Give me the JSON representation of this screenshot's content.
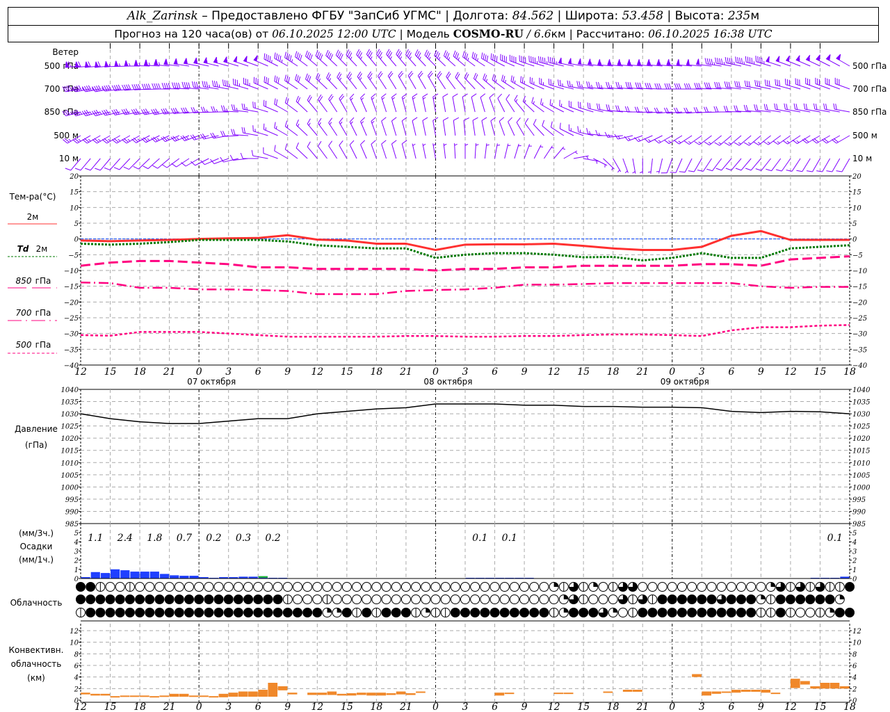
{
  "header": {
    "station": "Alk_Zarinsk",
    "provider": " – Предоставлено ФГБУ \"ЗапСиб УГМС\" | Долгота: ",
    "lon": "84.562",
    "lat_label": " | Широта: ",
    "lat": "53.458",
    "alt_label": " | Высота: ",
    "alt": "235",
    "alt_unit": "м",
    "forecast_prefix": "Прогноз на 120 часа(ов) от ",
    "forecast_time": "06.10.2025 12:00 UTC",
    "model_label": " | Модель ",
    "model": "COSMO-RU",
    "res_sep": " / ",
    "resolution": "6.6",
    "res_unit": "км",
    "calc_label": " | Рассчитано: ",
    "calc_time": "06.10.2025 16:38 UTC"
  },
  "labels": {
    "wind": "Ветер",
    "wind_levels": [
      "500 гПа",
      "700 гПа",
      "850 гПа",
      "500 м",
      "10 м"
    ],
    "temp_title": "Тем-ра(°С)",
    "t2m": "2м",
    "td_prefix": "Td",
    "td2m": "2м",
    "t850": "850",
    "t700": "700",
    "t500": "500",
    "hpa": "гПа",
    "pressure": "Давление",
    "pressure_unit": "(гПа)",
    "precip_3h": "(мм/3ч.)",
    "precip": "Осадки",
    "precip_1h": "(мм/1ч.)",
    "clouds": "Облачность",
    "conv1": "Конвективн.",
    "conv2": "облачность",
    "conv3": "(км)"
  },
  "time_axis": {
    "labels": [
      "12",
      "15",
      "18",
      "21",
      "0",
      "3",
      "6",
      "9",
      "12",
      "15",
      "18",
      "21",
      "0",
      "3",
      "6",
      "9",
      "12",
      "15",
      "18",
      "21",
      "0",
      "3",
      "6",
      "9",
      "12",
      "15",
      "18"
    ],
    "midnights_hours": [
      12,
      36,
      60
    ],
    "dates": [
      "07 октября",
      "08 октября",
      "09 октября"
    ]
  },
  "colors": {
    "wind": "#8000ff",
    "t2m": "#ff3030",
    "td2m": "#007a00",
    "upper": "#ff0080",
    "zero": "#0040ff",
    "pressure": "#000000",
    "precip": "#2040ff",
    "precip_mixed": "#20c020",
    "convective": "#f0882a"
  },
  "chart_data": [
    {
      "type": "barbs",
      "title": "Ветер",
      "step_hours": 3,
      "units": "m/s",
      "levels": [
        {
          "name": "500 гПа",
          "dir": [
            265,
            265,
            270,
            275,
            280,
            285,
            290,
            300,
            310,
            315,
            320,
            320,
            315,
            310,
            300,
            290,
            285,
            280,
            275,
            275,
            275,
            275,
            280,
            285,
            290,
            295,
            300
          ],
          "speed": [
            28,
            27,
            26,
            25,
            24,
            22,
            20,
            18,
            16,
            15,
            14,
            13,
            13,
            14,
            15,
            16,
            18,
            20,
            22,
            22,
            22,
            20,
            18,
            18,
            20,
            22,
            24
          ]
        },
        {
          "name": "700 гПа",
          "dir": [
            260,
            260,
            265,
            270,
            275,
            280,
            290,
            300,
            310,
            320,
            325,
            330,
            330,
            320,
            310,
            300,
            290,
            280,
            275,
            275,
            270,
            270,
            275,
            280,
            285,
            290,
            290
          ],
          "speed": [
            18,
            17,
            16,
            15,
            15,
            14,
            13,
            12,
            11,
            10,
            9,
            8,
            8,
            8,
            9,
            10,
            10,
            10,
            10,
            11,
            12,
            12,
            12,
            12,
            12,
            12,
            12
          ]
        },
        {
          "name": "850 гПа",
          "dir": [
            255,
            255,
            260,
            260,
            265,
            270,
            280,
            300,
            320,
            330,
            340,
            345,
            350,
            350,
            340,
            320,
            300,
            290,
            280,
            270,
            265,
            265,
            270,
            275,
            280,
            280,
            280
          ],
          "speed": [
            14,
            13,
            12,
            12,
            11,
            10,
            9,
            8,
            7,
            7,
            6,
            6,
            5,
            4,
            4,
            5,
            6,
            7,
            8,
            8,
            8,
            7,
            7,
            7,
            8,
            8,
            8
          ]
        },
        {
          "name": "500 м",
          "dir": [
            240,
            240,
            240,
            245,
            250,
            260,
            280,
            300,
            320,
            330,
            340,
            345,
            350,
            355,
            345,
            330,
            310,
            290,
            270,
            250,
            240,
            235,
            230,
            230,
            235,
            240,
            240
          ],
          "speed": [
            10,
            10,
            10,
            9,
            9,
            8,
            7,
            6,
            5,
            5,
            5,
            4,
            4,
            3,
            3,
            4,
            4,
            5,
            5,
            5,
            6,
            6,
            6,
            6,
            6,
            7,
            7
          ]
        },
        {
          "name": "10 м",
          "dir": [
            220,
            220,
            225,
            230,
            240,
            250,
            270,
            300,
            320,
            330,
            340,
            345,
            350,
            0,
            10,
            20,
            40,
            100,
            150,
            180,
            200,
            210,
            220,
            220,
            215,
            210,
            210
          ],
          "speed": [
            3,
            3,
            3,
            3,
            3,
            3,
            3,
            3,
            3,
            3,
            3,
            3,
            2,
            2,
            2,
            2,
            2,
            2,
            2,
            2,
            3,
            3,
            3,
            3,
            3,
            3,
            3
          ]
        }
      ]
    },
    {
      "type": "line",
      "title": "Тем-ра(°С)",
      "step_hours": 3,
      "ylim": [
        -40,
        20
      ],
      "yticks": [
        20,
        15,
        10,
        5,
        0,
        -5,
        -10,
        -15,
        -20,
        -25,
        -30,
        -35,
        -40
      ],
      "grid": true,
      "series": [
        {
          "name": "2м",
          "values": [
            -0.5,
            -0.7,
            -0.5,
            -0.3,
            0,
            0.2,
            0.3,
            1.2,
            -0.2,
            -0.5,
            -1.5,
            -1.5,
            -3.5,
            -1.8,
            -1.7,
            -1.7,
            -1.5,
            -2.2,
            -3.0,
            -3.5,
            -3.5,
            -2.5,
            1.0,
            2.5,
            -0.3,
            -0.3,
            -0.3
          ]
        },
        {
          "name": "Td 2м",
          "values": [
            -1.5,
            -1.8,
            -1.5,
            -1,
            -0.3,
            -0.3,
            -0.3,
            -0.8,
            -2,
            -2.5,
            -3,
            -3,
            -6,
            -5,
            -4.5,
            -4.5,
            -5,
            -5.8,
            -5.7,
            -6.8,
            -6,
            -4.5,
            -6,
            -6,
            -3,
            -2.5,
            -2
          ]
        },
        {
          "name": "850 гПа",
          "values": [
            -8.5,
            -7.5,
            -7,
            -7,
            -7.5,
            -8,
            -9,
            -9,
            -9.5,
            -9.5,
            -9.5,
            -9.5,
            -10,
            -9.5,
            -9.5,
            -9,
            -9,
            -8.5,
            -8.5,
            -8.5,
            -8.5,
            -8,
            -8,
            -8.5,
            -6.5,
            -6,
            -5.5
          ]
        },
        {
          "name": "700 гПа",
          "values": [
            -13.8,
            -14,
            -15.5,
            -15.5,
            -16,
            -16,
            -16.2,
            -16.5,
            -17.5,
            -17.5,
            -17.5,
            -16.5,
            -16.2,
            -16,
            -15.5,
            -14.5,
            -14.5,
            -14.3,
            -14,
            -14,
            -14,
            -14,
            -14,
            -15,
            -15.5,
            -15.2,
            -15.2
          ]
        },
        {
          "name": "500 гПа",
          "values": [
            -30.5,
            -30.7,
            -29.5,
            -29.5,
            -29.5,
            -30,
            -30.5,
            -31,
            -31,
            -31,
            -31,
            -30.8,
            -30.8,
            -31,
            -31,
            -30.8,
            -30.8,
            -30.5,
            -30.3,
            -30.3,
            -30.5,
            -30.8,
            -29,
            -28,
            -28,
            -27.5,
            -27.3
          ]
        }
      ]
    },
    {
      "type": "line",
      "title": "Давление",
      "ylabel": "(гПа)",
      "step_hours": 3,
      "ylim": [
        985,
        1040
      ],
      "yticks": [
        1040,
        1035,
        1030,
        1025,
        1020,
        1015,
        1010,
        1005,
        1000,
        995,
        990,
        985
      ],
      "grid": true,
      "values": [
        1030,
        1028,
        1026.7,
        1026,
        1026,
        1027,
        1028,
        1028,
        1030,
        1031,
        1032,
        1032.5,
        1034,
        1034,
        1034,
        1033.5,
        1033.5,
        1033,
        1033,
        1032.7,
        1032.7,
        1032.5,
        1031,
        1030.5,
        1031,
        1030.8,
        1030
      ]
    },
    {
      "type": "bar",
      "title": "Осадки",
      "ylabel": "(мм/1ч.)",
      "ylim": [
        0,
        5.5
      ],
      "yticks": [
        0,
        1,
        2,
        3,
        4,
        5
      ],
      "hourly_mm": [
        0.15,
        0.7,
        0.6,
        1.0,
        0.9,
        0.75,
        0.75,
        0.75,
        0.5,
        0.35,
        0.3,
        0.3,
        0.15,
        0.07,
        0.15,
        0.15,
        0.2,
        0.2,
        0.25,
        0.07,
        0.07,
        0,
        0,
        0,
        0,
        0,
        0,
        0,
        0,
        0,
        0,
        0,
        0,
        0,
        0,
        0,
        0,
        0,
        0,
        0.03,
        0.03,
        0.03,
        0.03,
        0.03,
        0.03,
        0.03,
        0,
        0,
        0,
        0,
        0,
        0,
        0,
        0,
        0,
        0,
        0,
        0,
        0,
        0,
        0,
        0,
        0,
        0,
        0,
        0,
        0,
        0,
        0,
        0,
        0,
        0,
        0,
        0,
        0.05,
        0.05,
        0.05,
        0.2
      ],
      "mixed_phase_hours": [
        18
      ],
      "sums_3h": [
        {
          "start_hour": 0,
          "value": "1.1"
        },
        {
          "start_hour": 3,
          "value": "2.4"
        },
        {
          "start_hour": 6,
          "value": "1.8"
        },
        {
          "start_hour": 9,
          "value": "0.7"
        },
        {
          "start_hour": 12,
          "value": "0.2"
        },
        {
          "start_hour": 15,
          "value": "0.3"
        },
        {
          "start_hour": 18,
          "value": "0.2"
        },
        {
          "start_hour": 39,
          "value": "0.1"
        },
        {
          "start_hour": 42,
          "value": "0.1"
        },
        {
          "start_hour": 75,
          "value": "0.1"
        }
      ]
    },
    {
      "type": "table",
      "title": "Облачность",
      "legend": "hourly cloud cover in quarters: 0 clear .. 4 overcast",
      "rows": [
        "44200200000000000000000000000000000000000000000012321023300000000000001323232244",
        "444444444444444444444200020000000000000000000000013200032324444443444124444441",
        "24444444444444444444444441142424442122444444444421444310244444444444422420021444"
      ]
    },
    {
      "type": "bar",
      "title": "Конвективн. облачность",
      "ylabel": "(км)",
      "ylim": [
        0,
        13
      ],
      "yticks": [
        0,
        2,
        4,
        6,
        8,
        10,
        12
      ],
      "bars_hour_base_top_km": [
        [
          0,
          1.0,
          1.3
        ],
        [
          1,
          0.8,
          1.1
        ],
        [
          2,
          0.8,
          1.1
        ],
        [
          3,
          0.6,
          0.7
        ],
        [
          4,
          0.6,
          0.8
        ],
        [
          5,
          0.6,
          0.8
        ],
        [
          6,
          0.6,
          0.8
        ],
        [
          7,
          0.6,
          0.7
        ],
        [
          8,
          0.6,
          0.8
        ],
        [
          9,
          0.6,
          1.1
        ],
        [
          10,
          0.6,
          1.1
        ],
        [
          11,
          0.6,
          0.8
        ],
        [
          12,
          0.6,
          0.8
        ],
        [
          13,
          0.6,
          0.7
        ],
        [
          14,
          0.5,
          1.1
        ],
        [
          15,
          0.6,
          1.3
        ],
        [
          16,
          0.6,
          1.5
        ],
        [
          17,
          0.6,
          1.5
        ],
        [
          18,
          0.6,
          1.8
        ],
        [
          19,
          0.6,
          3.0
        ],
        [
          20,
          1.7,
          2.4
        ],
        [
          21,
          1.0,
          1.3
        ],
        [
          23,
          0.9,
          1.3
        ],
        [
          24,
          0.9,
          1.3
        ],
        [
          25,
          0.9,
          1.5
        ],
        [
          26,
          0.8,
          1.1
        ],
        [
          27,
          0.8,
          1.2
        ],
        [
          28,
          0.9,
          1.3
        ],
        [
          29,
          0.8,
          1.3
        ],
        [
          30,
          0.8,
          1.3
        ],
        [
          31,
          0.9,
          1.2
        ],
        [
          32,
          1.0,
          1.5
        ],
        [
          33,
          0.9,
          1.2
        ],
        [
          34,
          1.3,
          1.5
        ],
        [
          42,
          0.8,
          1.3
        ],
        [
          43,
          1.1,
          1.3
        ],
        [
          48,
          1.1,
          1.3
        ],
        [
          49,
          1.1,
          1.3
        ],
        [
          53,
          1.3,
          1.5
        ],
        [
          55,
          1.45,
          1.8
        ],
        [
          56,
          1.45,
          1.8
        ],
        [
          62,
          4.0,
          4.5
        ],
        [
          63,
          0.8,
          1.5
        ],
        [
          64,
          1.1,
          1.5
        ],
        [
          65,
          1.3,
          1.5
        ],
        [
          66,
          1.3,
          1.8
        ],
        [
          67,
          1.45,
          1.8
        ],
        [
          68,
          1.45,
          1.8
        ],
        [
          69,
          1.3,
          1.8
        ],
        [
          70,
          1.1,
          1.3
        ],
        [
          72,
          2.1,
          3.7
        ],
        [
          73,
          2.7,
          3.3
        ],
        [
          74,
          2.0,
          2.4
        ],
        [
          75,
          2.0,
          3.0
        ],
        [
          76,
          2.0,
          3.0
        ],
        [
          77,
          2.0,
          2.4
        ]
      ]
    }
  ]
}
